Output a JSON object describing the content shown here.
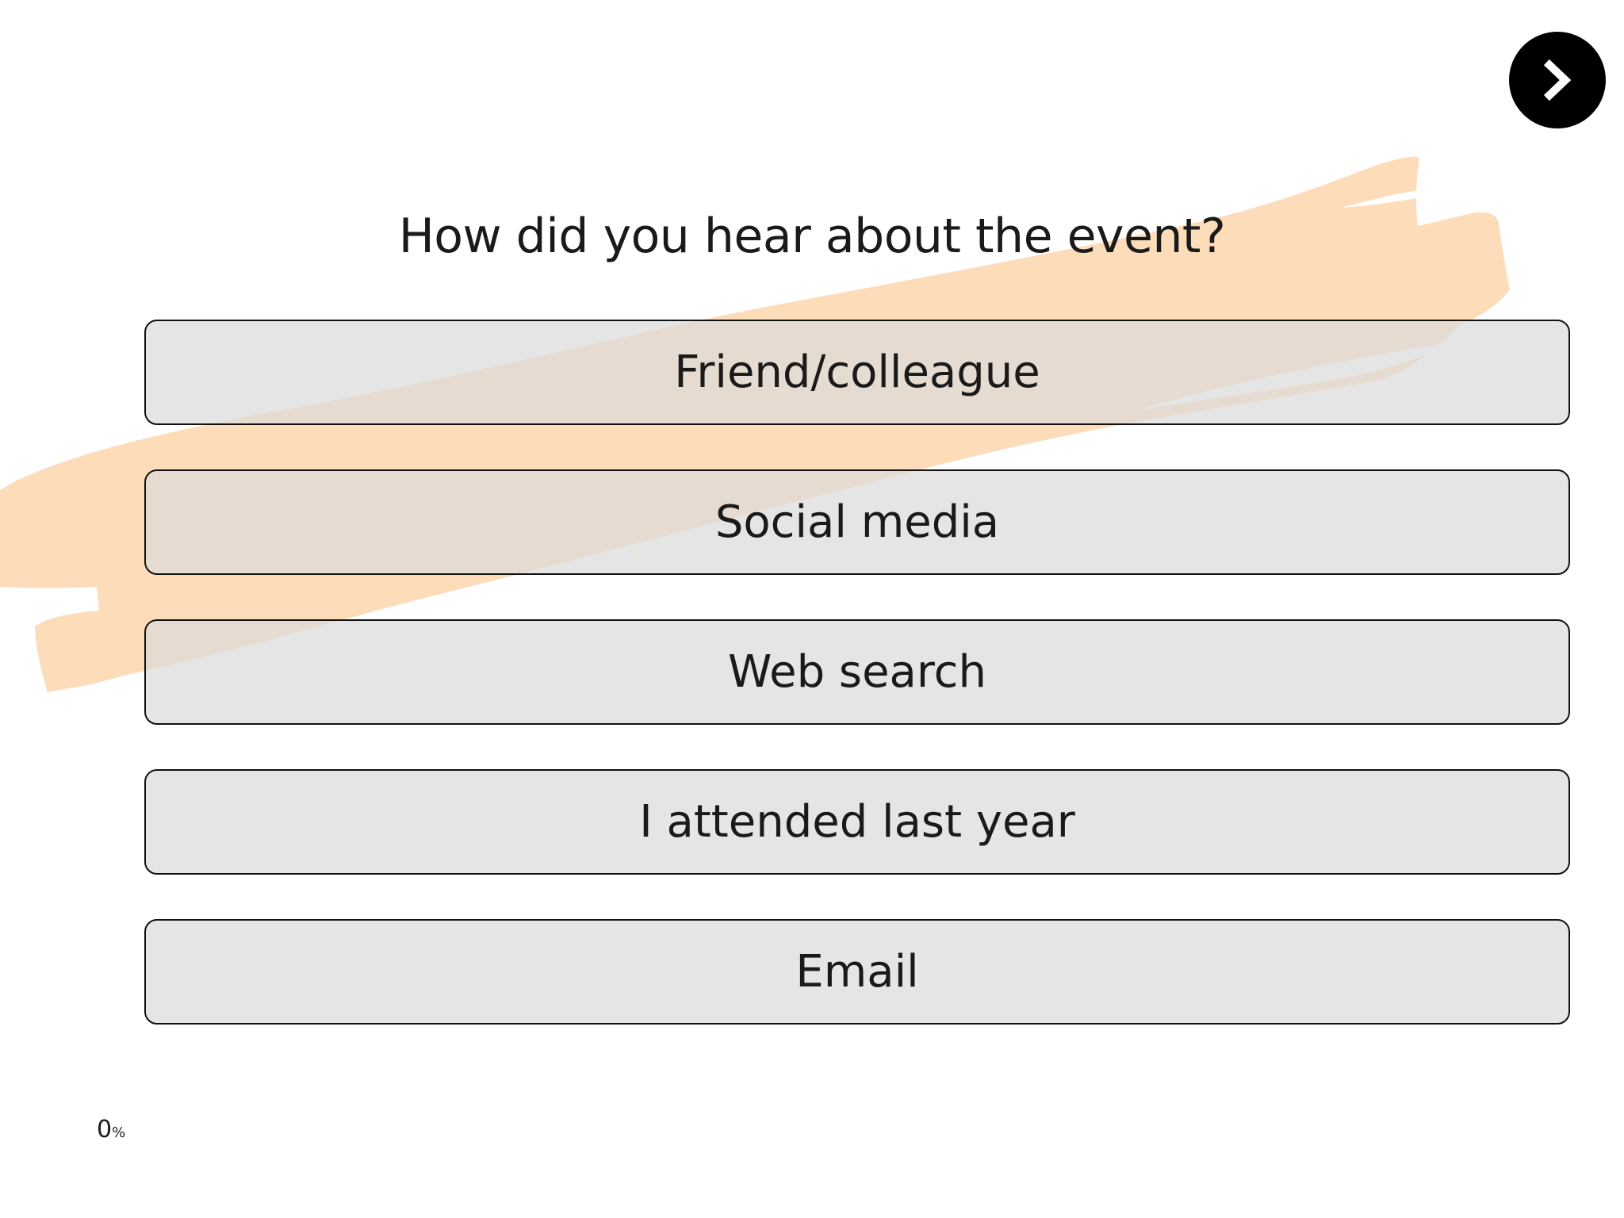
{
  "survey": {
    "question": "How did you hear about the event?",
    "options": [
      "Friend/colleague",
      "Social media",
      "Web search",
      "I attended last year",
      "Email"
    ]
  },
  "progress": {
    "value": "0",
    "unit": "%"
  },
  "navigation": {
    "next_icon": "chevron-right-icon"
  },
  "colors": {
    "brush_stroke": "#fddcb9",
    "option_background": "#e5e5e5",
    "next_button": "#000000"
  }
}
